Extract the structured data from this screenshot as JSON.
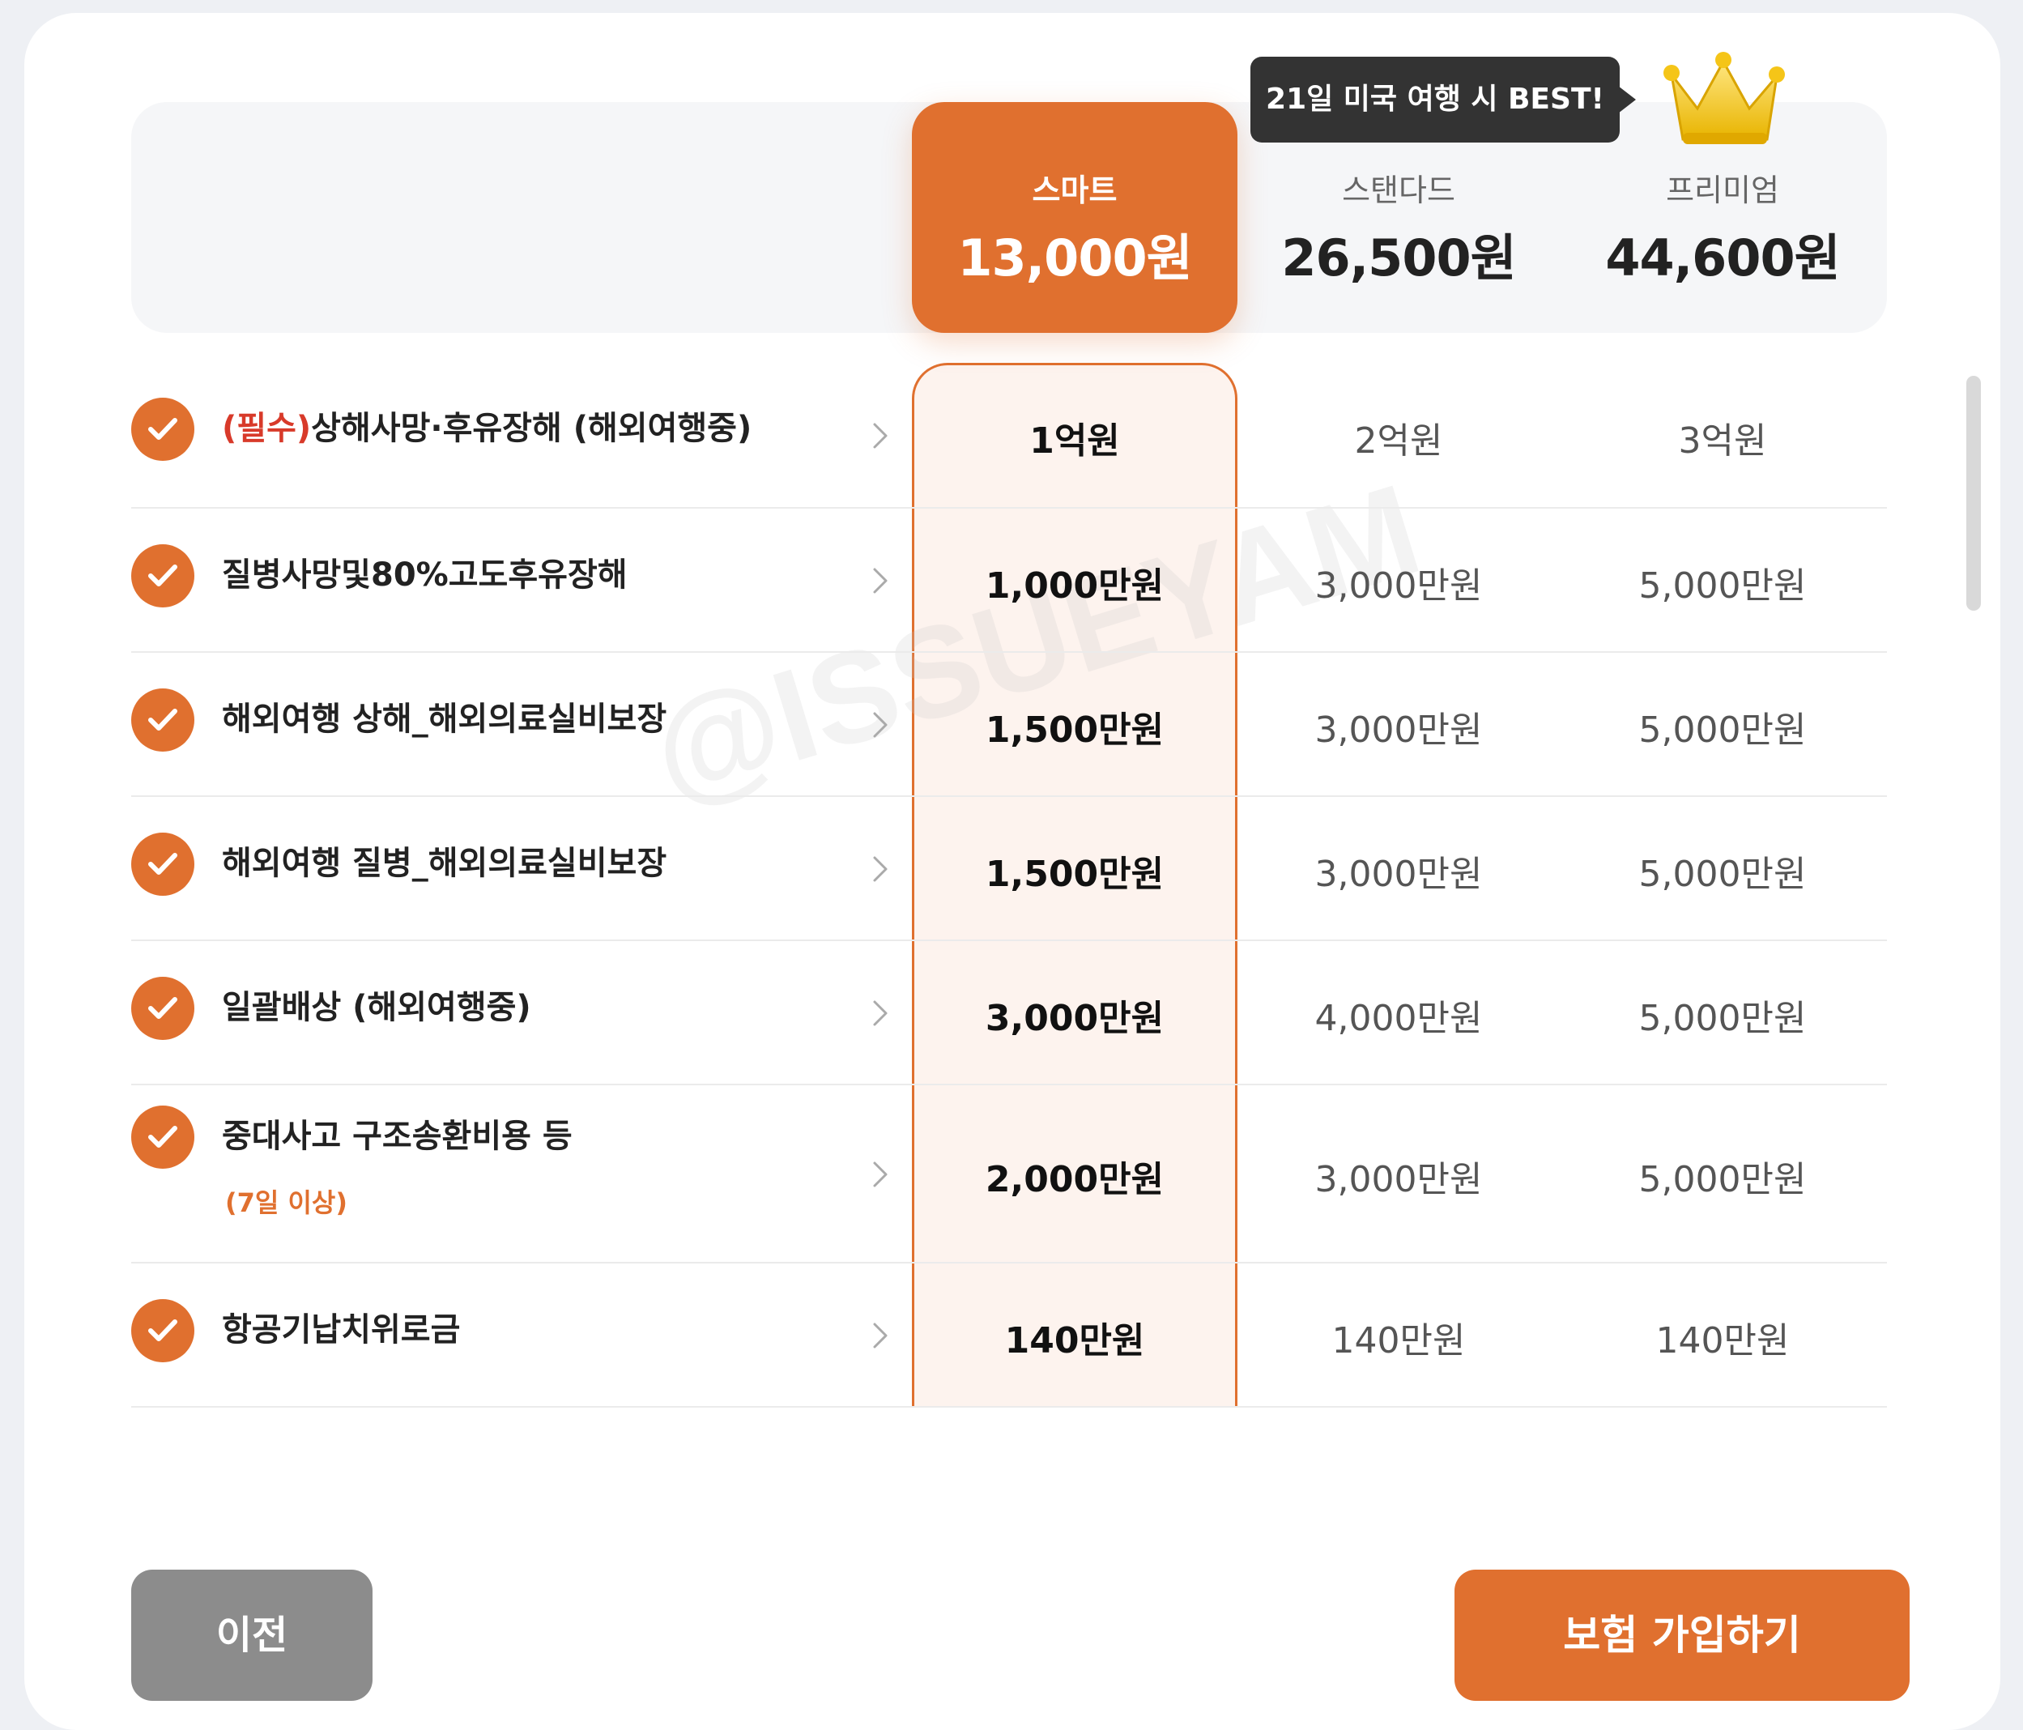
{
  "tooltip": "21일 미국 여행 시 BEST!",
  "plans": [
    {
      "name": "스마트",
      "price": "13,000원"
    },
    {
      "name": "스탠다드",
      "price": "26,500원"
    },
    {
      "name": "프리미엄",
      "price": "44,600원"
    }
  ],
  "coverages": [
    {
      "required_prefix": "(필수)",
      "label": "상해사망·후유장해 (해외여행중)",
      "sub": "",
      "values": [
        "1억원",
        "2억원",
        "3억원"
      ]
    },
    {
      "required_prefix": "",
      "label": "질병사망및80%고도후유장해",
      "sub": "",
      "values": [
        "1,000만원",
        "3,000만원",
        "5,000만원"
      ]
    },
    {
      "required_prefix": "",
      "label": "해외여행 상해_해외의료실비보장",
      "sub": "",
      "values": [
        "1,500만원",
        "3,000만원",
        "5,000만원"
      ]
    },
    {
      "required_prefix": "",
      "label": "해외여행 질병_해외의료실비보장",
      "sub": "",
      "values": [
        "1,500만원",
        "3,000만원",
        "5,000만원"
      ]
    },
    {
      "required_prefix": "",
      "label": "일괄배상 (해외여행중)",
      "sub": "",
      "values": [
        "3,000만원",
        "4,000만원",
        "5,000만원"
      ]
    },
    {
      "required_prefix": "",
      "label": "중대사고 구조송환비용 등",
      "sub": "(7일 이상)",
      "values": [
        "2,000만원",
        "3,000만원",
        "5,000만원"
      ]
    },
    {
      "required_prefix": "",
      "label": "항공기납치위로금",
      "sub": "",
      "values": [
        "140만원",
        "140만원",
        "140만원"
      ]
    }
  ],
  "buttons": {
    "prev": "이전",
    "join": "보험 가입하기"
  },
  "watermark": "@ISSUEYAM",
  "colors": {
    "accent": "#e0702f",
    "highlight_bg": "#fdf3ee",
    "required_text": "#d83a2a",
    "prev_button": "#8c8c8c"
  }
}
